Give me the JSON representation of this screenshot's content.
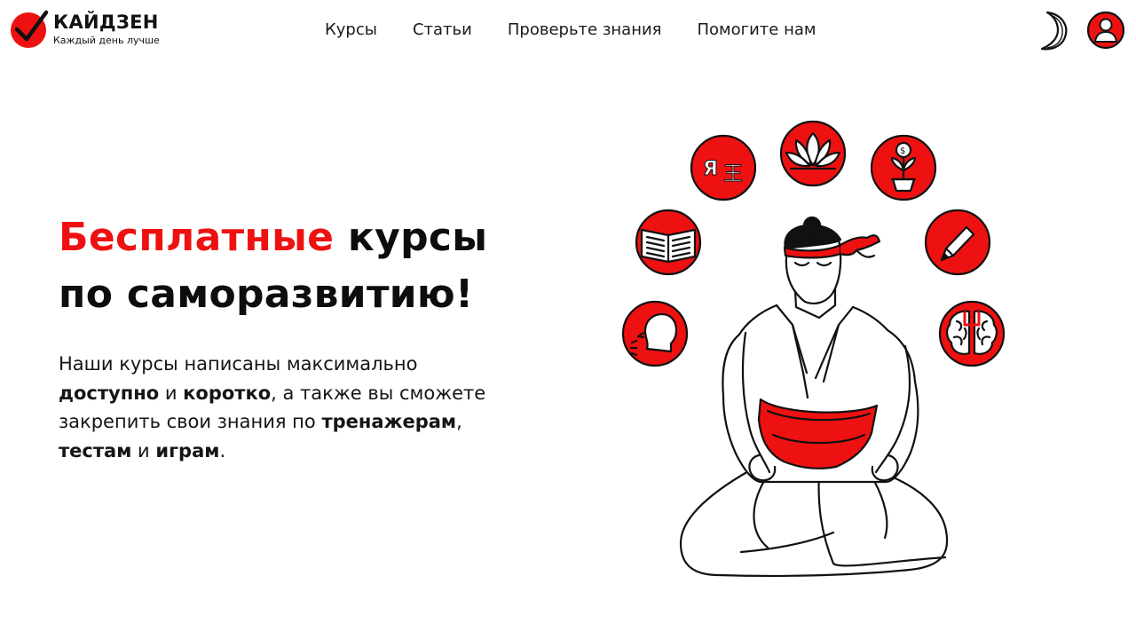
{
  "header": {
    "logo": {
      "title": "КАЙДЗЕН",
      "tagline": "Каждый день лучше",
      "icon": "check-mark-circle"
    },
    "nav": [
      {
        "label": "Курсы"
      },
      {
        "label": "Статьи"
      },
      {
        "label": "Проверьте знания"
      },
      {
        "label": "Помогите нам"
      }
    ],
    "theme_toggle_icon": "moon-icon",
    "profile_icon": "user-icon"
  },
  "hero": {
    "title_accent": "Бесплатные",
    "title_rest": " курсы по саморазвитию!",
    "description": {
      "p1": "Наши курсы написаны максимально ",
      "b1": "доступно",
      "p2": " и ",
      "b2": "коротко",
      "p3": ", а также вы сможете закрепить свои знания по ",
      "b3": "тренажерам",
      "p4": ", ",
      "b4": "тестам",
      "p5": " и ",
      "b5": "играм",
      "p6": "."
    }
  },
  "illustration": {
    "subject": "meditating-figure",
    "icons": [
      "speech-icon",
      "book-icon",
      "language-icon",
      "lotus-icon",
      "money-plant-icon",
      "pencil-icon",
      "brain-icon"
    ],
    "language_icon_glyphs": "Я 王"
  },
  "colors": {
    "accent": "#ee1111",
    "text": "#111111",
    "background": "#ffffff"
  }
}
